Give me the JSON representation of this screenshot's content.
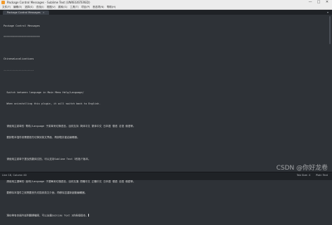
{
  "window": {
    "title": "Package Control Messages - Sublime Text (UNREGISTERED)",
    "controls": {
      "minimize": "—",
      "maximize": "□",
      "close": "✕"
    }
  },
  "menu": {
    "items": [
      "文件(F)",
      "编辑(E)",
      "选择(S)",
      "查找(I)",
      "视图(V)",
      "跳转(G)",
      "工具(T)",
      "项目(P)",
      "首选项(N)",
      "帮助(H)"
    ]
  },
  "tab": {
    "label": "Package Control Messages",
    "close": "×"
  },
  "editor": {
    "lines": [
      "Package Control Messages",
      "========================",
      "",
      "ChineseLocalizations",
      "--------------------",
      "",
      "  Switch between language in Main Menu Help/Language/",
      "  When uninstalling this plugin, it will switch back to English.",
      "",
      "  请使用主菜单的 帮助/Language 子菜单来切换语言。目前支持 简体中文 繁体中文 日本語 德语 法语 俄语等。",
      "  要卸载本插件前需要首先切换到英文界面，再卸载并重启编辑器。",
      "",
      "  请使用主菜单下提及的翻译文档，可以支持Sublime Text 3的各个版本。",
      "",
      "  請使用主選單的 說明/Language 子選單來切換語言。目前支援 簡體中文 正體中文 日本語 德語 法語 俄語等。",
      "  要移除本插件之前需要首先切換到英文介面，再移除並重新啟動編輯器。",
      "",
      "  現在帶有本插件並附翻譯檔案，可以支援Sublime Text 3的各個版本。"
    ]
  },
  "status": {
    "left": "Line 18, Column 40",
    "tab_size": "Tab Size: 4",
    "syntax": "Plain Text"
  },
  "watermark": "CSDN @你好龙卷"
}
